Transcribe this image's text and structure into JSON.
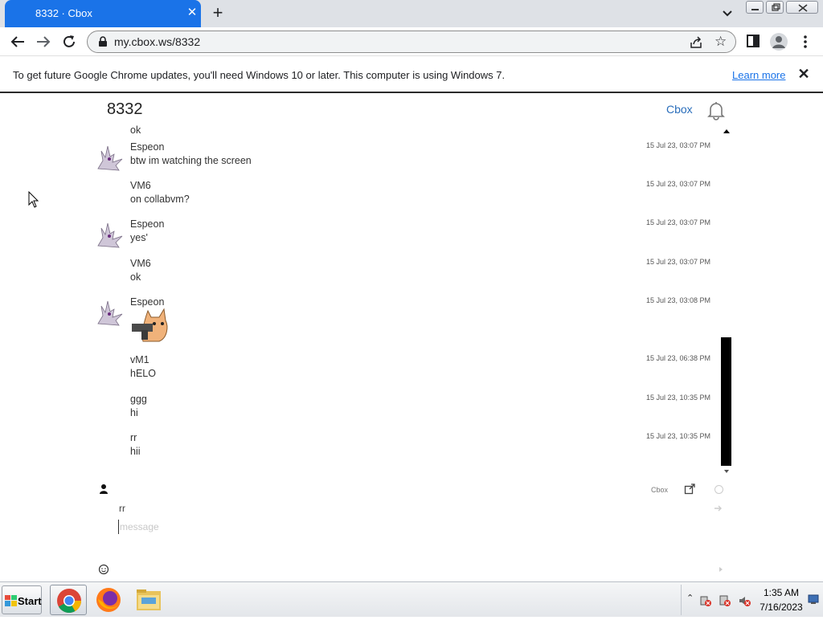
{
  "browser": {
    "tab_title": "8332 · Cbox",
    "url": "my.cbox.ws/8332",
    "infobar_text": "To get future Google Chrome updates, you'll need Windows 10 or later. This computer is using Windows 7.",
    "infobar_link": "Learn more"
  },
  "cbox": {
    "title": "8332",
    "cbox_link": "Cbox",
    "messages": [
      {
        "name": "",
        "text": "ok",
        "time": "",
        "avatar": false
      },
      {
        "name": "Espeon",
        "text": "btw im watching the screen",
        "time": "15 Jul 23, 03:07 PM",
        "avatar": true
      },
      {
        "name": "VM6",
        "text": "on collabvm?",
        "time": "15 Jul 23, 03:07 PM",
        "avatar": false
      },
      {
        "name": "Espeon",
        "text": "yes'",
        "time": "15 Jul 23, 03:07 PM",
        "avatar": true
      },
      {
        "name": "VM6",
        "text": "ok",
        "time": "15 Jul 23, 03:07 PM",
        "avatar": false
      },
      {
        "name": "Espeon",
        "text": "",
        "time": "15 Jul 23, 03:08 PM",
        "avatar": true,
        "sticker": "cat-with-gun"
      },
      {
        "name": "vM1",
        "text": "hELO",
        "time": "15 Jul 23, 06:38 PM",
        "avatar": false
      },
      {
        "name": "ggg",
        "text": "hi",
        "time": "15 Jul 23, 10:35 PM",
        "avatar": false
      },
      {
        "name": "rr",
        "text": "hii",
        "time": "15 Jul 23, 10:35 PM",
        "avatar": false
      }
    ],
    "footer_brand": "Cbox",
    "name_value": "rr",
    "message_placeholder": "message"
  },
  "taskbar": {
    "start_label": "Start",
    "time": "1:35 AM",
    "date": "7/16/2023"
  },
  "colors": {
    "tab_active": "#1a73e8",
    "link": "#2a6ebb",
    "scroll_thumb": "#000000"
  }
}
